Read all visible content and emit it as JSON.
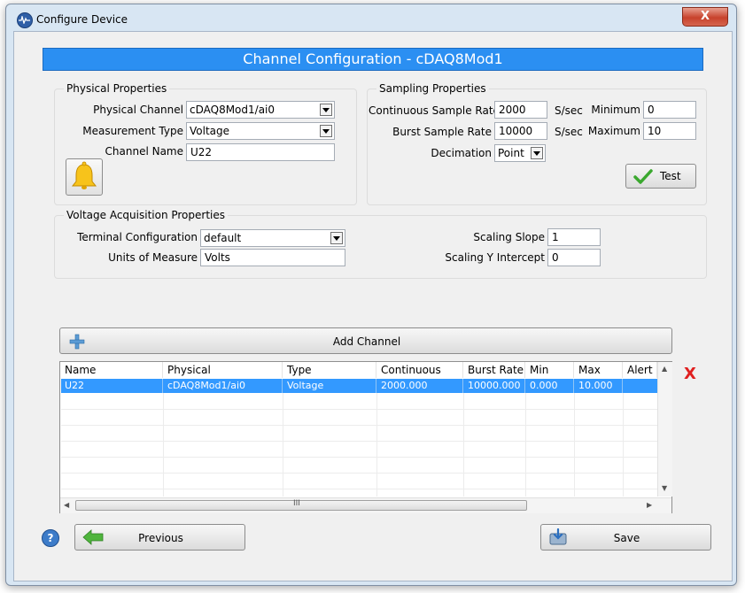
{
  "window": {
    "title": "Configure Device",
    "close_label": "X"
  },
  "banner": "Channel Configuration - cDAQ8Mod1",
  "physical": {
    "group_title": "Physical Properties",
    "channel_label": "Physical Channel",
    "channel_value": "cDAQ8Mod1/ai0",
    "measurement_label": "Measurement Type",
    "measurement_value": "Voltage",
    "name_label": "Channel Name",
    "name_value": "U22",
    "alert_icon": "bell-icon"
  },
  "sampling": {
    "group_title": "Sampling Properties",
    "continuous_label": "Continuous Sample Rate",
    "continuous_value": "2000",
    "continuous_unit": "S/sec",
    "burst_label": "Burst Sample Rate",
    "burst_value": "10000",
    "burst_unit": "S/sec",
    "decimation_label": "Decimation",
    "decimation_value": "Point",
    "minimum_label": "Minimum",
    "minimum_value": "0",
    "maximum_label": "Maximum",
    "maximum_value": "10",
    "test_label": "Test"
  },
  "voltage": {
    "group_title": "Voltage Acquisition Properties",
    "terminal_label": "Terminal Configuration",
    "terminal_value": "default",
    "units_label": "Units of Measure",
    "units_value": "Volts",
    "slope_label": "Scaling Slope",
    "slope_value": "1",
    "intercept_label": "Scaling Y Intercept",
    "intercept_value": "0"
  },
  "add_channel_label": "Add Channel",
  "table": {
    "columns": [
      "Name",
      "Physical",
      "Type",
      "Continuous Rate",
      "Burst Rate",
      "Min",
      "Max",
      "Alert"
    ],
    "rows": [
      {
        "name": "U22",
        "physical": "cDAQ8Mod1/ai0",
        "type": "Voltage",
        "continuous_rate": "2000.000",
        "burst_rate": "10000.000",
        "min": "0.000",
        "max": "10.000",
        "alert": ""
      }
    ],
    "hscroll_grip": "III"
  },
  "delete_icon_label": "X",
  "footer": {
    "previous_label": "Previous",
    "save_label": "Save",
    "help_label": "?"
  },
  "colors": {
    "banner": "#2b8ff2",
    "selection": "#3399ff",
    "delete": "#e02020",
    "bell": "#f7c31b"
  }
}
